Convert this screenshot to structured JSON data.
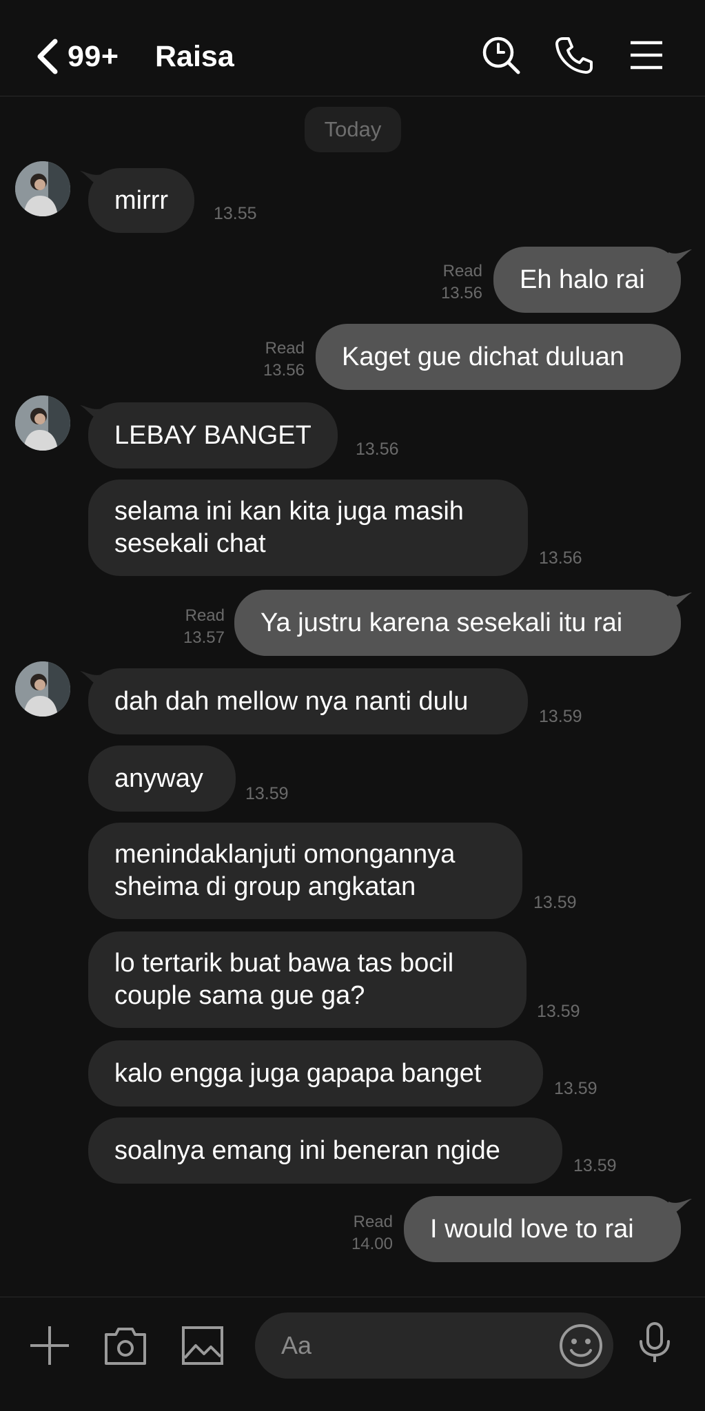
{
  "header": {
    "unread_count": "99+",
    "contact_name": "Raisa"
  },
  "date_label": "Today",
  "messages": [
    {
      "text": "mirrr",
      "time": "13.55"
    },
    {
      "text": "Eh halo rai",
      "read": "Read",
      "time": "13.56"
    },
    {
      "text": "Kaget gue dichat duluan",
      "read": "Read",
      "time": "13.56"
    },
    {
      "text": "LEBAY BANGET",
      "time": "13.56"
    },
    {
      "text": "selama ini kan kita juga masih sesekali chat",
      "time": "13.56"
    },
    {
      "text": "Ya justru karena sesekali itu rai",
      "read": "Read",
      "time": "13.57"
    },
    {
      "text": "dah dah mellow nya nanti dulu",
      "time": "13.59"
    },
    {
      "text": "anyway",
      "time": "13.59"
    },
    {
      "text": "menindaklanjuti omongannya sheima di group angkatan",
      "time": "13.59"
    },
    {
      "text": "lo tertarik buat bawa tas bocil couple sama gue ga?",
      "time": "13.59"
    },
    {
      "text": "kalo engga juga gapapa banget",
      "time": "13.59"
    },
    {
      "text": "soalnya emang ini beneran ngide",
      "time": "13.59"
    },
    {
      "text": "I would love to rai",
      "read": "Read",
      "time": "14.00"
    }
  ],
  "composer": {
    "placeholder": "Aa"
  },
  "icons": {
    "back": "chevron-left-icon",
    "search": "search-icon",
    "call": "phone-icon",
    "menu": "menu-icon",
    "add": "plus-icon",
    "camera": "camera-icon",
    "gallery": "image-icon",
    "emoji": "emoji-icon",
    "mic": "microphone-icon"
  },
  "colors": {
    "background": "#111111",
    "incoming_bubble": "#282828",
    "outgoing_bubble": "#545454",
    "meta_text": "#6a6a6a"
  }
}
